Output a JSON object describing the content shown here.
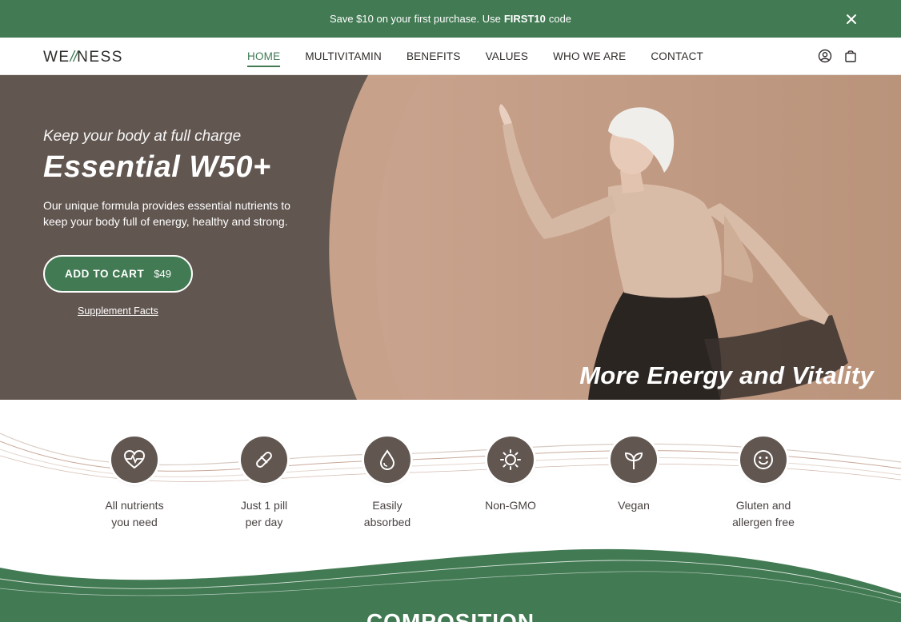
{
  "promo": {
    "text_before": "Save $10 on your first purchase. Use",
    "code": "FIRST10",
    "text_after": "code",
    "close_icon": "close-icon"
  },
  "header": {
    "logo_a": "WE",
    "logo_b": "//",
    "logo_c": "NESS",
    "nav": [
      "HOME",
      "MULTIVITAMIN",
      "BENEFITS",
      "VALUES",
      "WHO WE ARE",
      "CONTACT"
    ],
    "active_nav": "HOME",
    "icons": [
      "user-icon",
      "bag-icon"
    ]
  },
  "hero": {
    "tagline": "Keep your body at full charge",
    "title": "Essential W50+",
    "description": "Our unique formula provides essential nutrients to keep your body full of energy, healthy and strong.",
    "cart_label": "ADD TO CART",
    "price": "$49",
    "facts_link": "Supplement Facts",
    "slogan": "More Energy and Vitality"
  },
  "features": [
    {
      "icon": "heart-pulse-icon",
      "line1": "All nutrients",
      "line2": "you need"
    },
    {
      "icon": "pill-icon",
      "line1": "Just 1 pill",
      "line2": "per day"
    },
    {
      "icon": "drop-icon",
      "line1": "Easily",
      "line2": "absorbed"
    },
    {
      "icon": "sun-icon",
      "line1": "Non-GMO",
      "line2": ""
    },
    {
      "icon": "sprout-icon",
      "line1": "Vegan",
      "line2": ""
    },
    {
      "icon": "smile-icon",
      "line1": "Gluten and",
      "line2": "allergen free"
    }
  ],
  "composition": {
    "title": "COMPOSITION"
  },
  "colors": {
    "brand_green": "#427a53",
    "hero_brown": "#615650",
    "hero_tan": "#c39c84",
    "icon_brown": "#615650"
  }
}
